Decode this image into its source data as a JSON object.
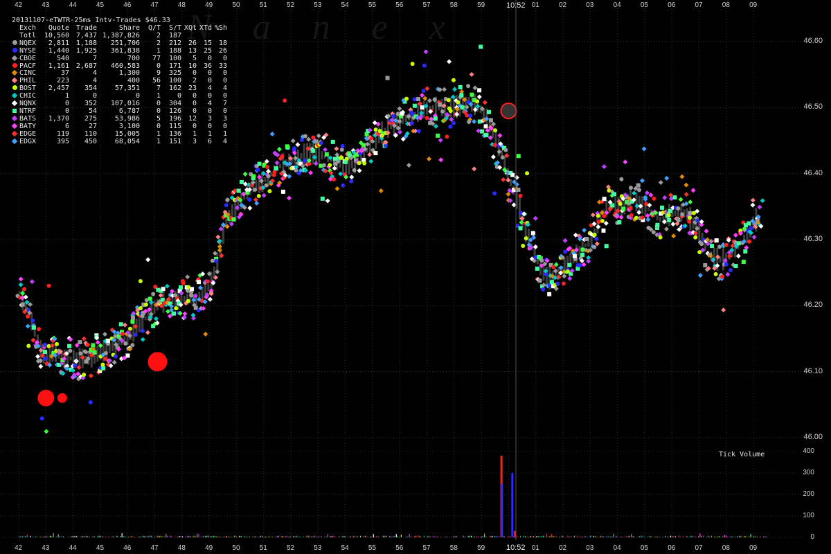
{
  "chart_data": {
    "type": "scatter",
    "title": "20131107-eTWTR-25ms Intv-Trades $46.33",
    "watermark": "Nanex",
    "x_ticks_top": [
      "42",
      "43",
      "44",
      "45",
      "46",
      "47",
      "48",
      "49",
      "50",
      "51",
      "52",
      "53",
      "54",
      "55",
      "56",
      "57",
      "58",
      "59",
      "10:52",
      "01",
      "02",
      "03",
      "04",
      "05",
      "06",
      "07",
      "08",
      "09"
    ],
    "x_ticks_bottom": [
      "42",
      "43",
      "44",
      "45",
      "46",
      "47",
      "48",
      "49",
      "50",
      "51",
      "52",
      "53",
      "54",
      "55",
      "56",
      "57",
      "58",
      "59",
      "10:52",
      "01",
      "02",
      "03",
      "04",
      "05",
      "06",
      "07",
      "08",
      "09"
    ],
    "cursor_time": "10:52",
    "y_ticks": [
      "46.60",
      "46.50",
      "46.40",
      "46.30",
      "46.20",
      "46.10",
      "46.00"
    ],
    "ylim": [
      46.0,
      46.65
    ],
    "volume_label": "Tick Volume",
    "volume_ticks": [
      "400",
      "300",
      "200",
      "100",
      "0"
    ],
    "volume_ylim": [
      0,
      400
    ],
    "legend_header": {
      "exch": "Exch",
      "quote": "Quote",
      "trade": "Trade",
      "share": "Share",
      "qt": "Q/T",
      "st": "S/T",
      "xqt": "XQt",
      "xtd": "XTd",
      "xsh": "%Sh"
    },
    "legend_total": {
      "name": "Totl",
      "quote": "10,560",
      "trade": "7,437",
      "share": "1,387,826",
      "qt": "2",
      "st": "187",
      "xqt": "",
      "xtd": "",
      "xsh": ""
    },
    "legend_rows": [
      {
        "name": "NQEX",
        "quote": "2,811",
        "trade": "1,188",
        "share": "251,706",
        "qt": "2",
        "st": "212",
        "xqt": "26",
        "xtd": "15",
        "xsh": "18",
        "color": "#9a9a9a",
        "shape": "dot"
      },
      {
        "name": "NYSE",
        "quote": "1,440",
        "trade": "1,925",
        "share": "361,838",
        "qt": "1",
        "st": "188",
        "xqt": "13",
        "xtd": "25",
        "xsh": "26",
        "color": "#2a2aff",
        "shape": "dot"
      },
      {
        "name": "CBOE",
        "quote": "540",
        "trade": "7",
        "share": "700",
        "qt": "77",
        "st": "100",
        "xqt": "5",
        "xtd": "0",
        "xsh": "0",
        "color": "#9a9a9a",
        "shape": "diam"
      },
      {
        "name": "PACF",
        "quote": "1,161",
        "trade": "2,687",
        "share": "460,583",
        "qt": "0",
        "st": "171",
        "xqt": "10",
        "xtd": "36",
        "xsh": "33",
        "color": "#ff2020",
        "shape": "dot"
      },
      {
        "name": "CINC",
        "quote": "37",
        "trade": "4",
        "share": "1,300",
        "qt": "9",
        "st": "325",
        "xqt": "0",
        "xtd": "0",
        "xsh": "0",
        "color": "#e08a00",
        "shape": "diam"
      },
      {
        "name": "PHIL",
        "quote": "223",
        "trade": "4",
        "share": "400",
        "qt": "56",
        "st": "100",
        "xqt": "2",
        "xtd": "0",
        "xsh": "0",
        "color": "#ff8080",
        "shape": "diam"
      },
      {
        "name": "BOST",
        "quote": "2,457",
        "trade": "354",
        "share": "57,351",
        "qt": "7",
        "st": "162",
        "xqt": "23",
        "xtd": "4",
        "xsh": "4",
        "color": "#c8ff00",
        "shape": "dot"
      },
      {
        "name": "CHIC",
        "quote": "1",
        "trade": "0",
        "share": "0",
        "qt": "1",
        "st": "0",
        "xqt": "0",
        "xtd": "0",
        "xsh": "0",
        "color": "#00c8c8",
        "shape": "diam"
      },
      {
        "name": "NQNX",
        "quote": "0",
        "trade": "352",
        "share": "107,016",
        "qt": "0",
        "st": "304",
        "xqt": "0",
        "xtd": "4",
        "xsh": "7",
        "color": "#ffffff",
        "shape": "diam"
      },
      {
        "name": "NTRF",
        "quote": "0",
        "trade": "54",
        "share": "6,787",
        "qt": "0",
        "st": "126",
        "xqt": "0",
        "xtd": "0",
        "xsh": "0",
        "color": "#40ffa0",
        "shape": "sq"
      },
      {
        "name": "BATS",
        "quote": "1,370",
        "trade": "275",
        "share": "53,986",
        "qt": "5",
        "st": "196",
        "xqt": "12",
        "xtd": "3",
        "xsh": "3",
        "color": "#c040ff",
        "shape": "diam"
      },
      {
        "name": "BATY",
        "quote": "6",
        "trade": "27",
        "share": "3,100",
        "qt": "0",
        "st": "115",
        "xqt": "0",
        "xtd": "0",
        "xsh": "0",
        "color": "#ff40ff",
        "shape": "diam"
      },
      {
        "name": "EDGE",
        "quote": "119",
        "trade": "110",
        "share": "15,005",
        "qt": "1",
        "st": "136",
        "xqt": "1",
        "xtd": "1",
        "xsh": "1",
        "color": "#ff3030",
        "shape": "diam"
      },
      {
        "name": "EDGX",
        "quote": "395",
        "trade": "450",
        "share": "68,054",
        "qt": "1",
        "st": "151",
        "xqt": "3",
        "xtd": "6",
        "xsh": "4",
        "color": "#40a0ff",
        "shape": "diam"
      }
    ],
    "price_path": [
      [
        0.0,
        46.22
      ],
      [
        0.5,
        46.17
      ],
      [
        0.8,
        46.13
      ],
      [
        1.0,
        46.12
      ],
      [
        1.3,
        46.13
      ],
      [
        1.6,
        46.12
      ],
      [
        2.0,
        46.12
      ],
      [
        2.5,
        46.12
      ],
      [
        3.0,
        46.13
      ],
      [
        3.5,
        46.14
      ],
      [
        4.0,
        46.15
      ],
      [
        4.3,
        46.17
      ],
      [
        4.6,
        46.18
      ],
      [
        5.0,
        46.2
      ],
      [
        5.5,
        46.21
      ],
      [
        6.0,
        46.21
      ],
      [
        6.5,
        46.21
      ],
      [
        7.0,
        46.23
      ],
      [
        7.3,
        46.27
      ],
      [
        7.6,
        46.33
      ],
      [
        8.0,
        46.35
      ],
      [
        8.3,
        46.37
      ],
      [
        8.6,
        46.38
      ],
      [
        9.0,
        46.39
      ],
      [
        9.5,
        46.41
      ],
      [
        10.0,
        46.42
      ],
      [
        10.5,
        46.43
      ],
      [
        11.0,
        46.43
      ],
      [
        11.5,
        46.42
      ],
      [
        12.0,
        46.41
      ],
      [
        12.5,
        46.42
      ],
      [
        13.0,
        46.45
      ],
      [
        13.5,
        46.47
      ],
      [
        14.0,
        46.48
      ],
      [
        14.5,
        46.49
      ],
      [
        15.0,
        46.5
      ],
      [
        15.5,
        46.5
      ],
      [
        16.0,
        46.5
      ],
      [
        16.5,
        46.51
      ],
      [
        16.9,
        46.5
      ],
      [
        17.2,
        46.48
      ],
      [
        17.5,
        46.45
      ],
      [
        17.7,
        46.43
      ],
      [
        18.0,
        46.39
      ],
      [
        18.3,
        46.36
      ],
      [
        18.6,
        46.31
      ],
      [
        18.9,
        46.28
      ],
      [
        19.2,
        46.25
      ],
      [
        19.5,
        46.24
      ],
      [
        19.8,
        46.25
      ],
      [
        20.0,
        46.26
      ],
      [
        20.5,
        46.28
      ],
      [
        21.0,
        46.3
      ],
      [
        21.3,
        46.33
      ],
      [
        21.6,
        46.35
      ],
      [
        22.0,
        46.35
      ],
      [
        22.5,
        46.36
      ],
      [
        23.0,
        46.35
      ],
      [
        23.5,
        46.33
      ],
      [
        24.0,
        46.34
      ],
      [
        24.5,
        46.34
      ],
      [
        25.0,
        46.31
      ],
      [
        25.3,
        46.28
      ],
      [
        25.6,
        46.27
      ],
      [
        26.0,
        46.27
      ],
      [
        26.4,
        46.29
      ],
      [
        26.8,
        46.31
      ],
      [
        27.0,
        46.33
      ],
      [
        27.3,
        46.33
      ]
    ],
    "volume_spikes": [
      {
        "minute": 17.7,
        "value": 380,
        "color": "#ff2020"
      },
      {
        "minute": 17.72,
        "value": 250,
        "color": "#2a2aff"
      },
      {
        "minute": 18.1,
        "value": 300,
        "color": "#2a2aff"
      },
      {
        "minute": 18.2,
        "value": 30,
        "color": "#ff2020"
      }
    ]
  }
}
